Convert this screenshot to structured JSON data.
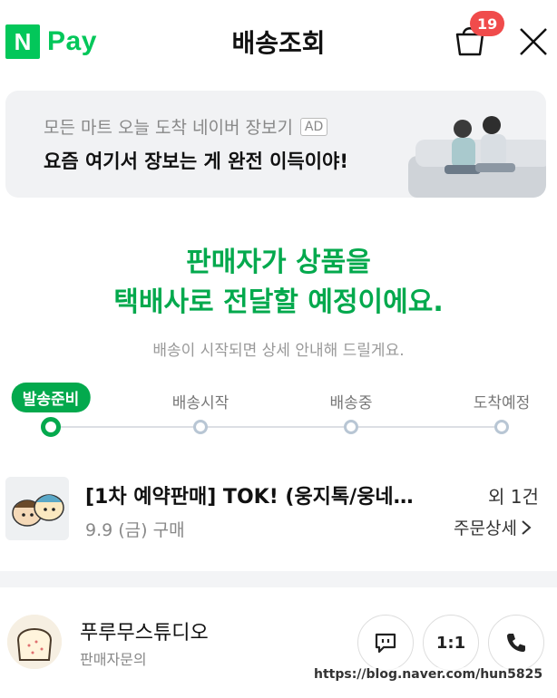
{
  "header": {
    "logo_n": "N",
    "logo_pay": "Pay",
    "title": "배송조회",
    "cart_count": "19"
  },
  "ad": {
    "line1": "모든 마트 오늘 도착 네이버 장보기",
    "tag": "AD",
    "line2": "요즘 여기서 장보는 게 완전 이득이야!"
  },
  "status": {
    "headline_1": "판매자가 상품을",
    "headline_2": "택배사로 전달할 예정이에요.",
    "sub": "배송이 시작되면 상세 안내해 드릴게요."
  },
  "progress": {
    "steps": [
      {
        "label": "발송준비",
        "active": true
      },
      {
        "label": "배송시작",
        "active": false
      },
      {
        "label": "배송중",
        "active": false
      },
      {
        "label": "도착예정",
        "active": false
      }
    ]
  },
  "order": {
    "title": "[1차 예약판매] TOK! (웅지톡/웅네…",
    "count": "외 1건",
    "date": "9.9 (금) 구매",
    "detail": "주문상세"
  },
  "seller": {
    "name": "푸루무스튜디오",
    "sub": "판매자문의",
    "one_to_one": "1:1"
  },
  "watermark": "https://blog.naver.com/hun5825",
  "colors": {
    "brand_green": "#03c75a",
    "status_green": "#03a94d",
    "badge_red": "#f04b4b"
  }
}
